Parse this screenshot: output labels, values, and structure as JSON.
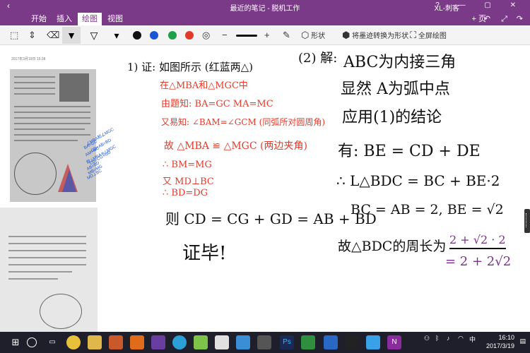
{
  "titlebar": {
    "back": "‹",
    "title": "最近的笔记 - 脱机工作",
    "user": "XL-刺客",
    "window_buttons": "?  —  ▢  ✕"
  },
  "tabs": [
    "开始",
    "插入",
    "绘图",
    "视图"
  ],
  "active_tab": "绘图",
  "tabrow": {
    "new_page": "+ 页",
    "icons": [
      "undo-icon",
      "fullscreen-icon",
      "redo-icon"
    ]
  },
  "ribbon": {
    "shape_label": "形状",
    "ink_to_shape_label": "将墨迹转换为形状",
    "fullscreen_label": "全屏绘图",
    "colors": [
      "#111111",
      "#1a55d6",
      "#1ea048",
      "#e23b2c"
    ]
  },
  "page": {
    "date": "2017年3月19日   15:38",
    "blue_note": [
      "∠MBA和∠MGC",
      "BA=GC",
      "CD+AB=BD",
      "AM=MC",
      "故△MBA≅△MGC",
      "CD=CG+GD",
      "AB=BD",
      "MB=MG",
      "MD⊥BC"
    ],
    "part1": {
      "label": "1) 证: 如图所示 (红蓝两△)",
      "red_lines": [
        "在△MBA和△MGC中",
        "由题知: BA=GC  MA=MC",
        "又易知: ∠BAM=∠GCM (同弧所对圆周角)",
        "故 △MBA ≌ △MGC (两边夹角)",
        "∴ BM=MG",
        "又 MD⊥BC",
        "∴ BD=DG"
      ],
      "conclusion": "则 CD = CG + GD = AB + BD",
      "end": "证毕!"
    },
    "part2": {
      "label": "(2) 解:",
      "lines": [
        "ABC为内接三角",
        "显然 A为弧中点",
        "应用(1)的结论",
        "有: BE = CD + DE",
        "∴ L△BDC = BC + BE·2",
        "BC = AB = 2,  BE = √2",
        "故△BDC的周长为"
      ],
      "fraction_num": "2 + √2 · 2",
      "fraction_result": "= 2 + 2√2"
    }
  },
  "taskbar": {
    "apps": [
      "windows-icon",
      "search-icon",
      "taskview-icon",
      "chrome-icon",
      "files-icon",
      "matlab-icon",
      "vs-icon",
      "chat-icon",
      "notes-icon",
      "wechat-icon",
      "store-icon",
      "app-icon",
      "photoshop-icon",
      "green-app-icon",
      "grid-app-icon",
      "qq-icon",
      "blue-app-icon",
      "onenote-icon"
    ],
    "tray_lang": "中",
    "time": "16:10",
    "date": "2017/3/19"
  }
}
